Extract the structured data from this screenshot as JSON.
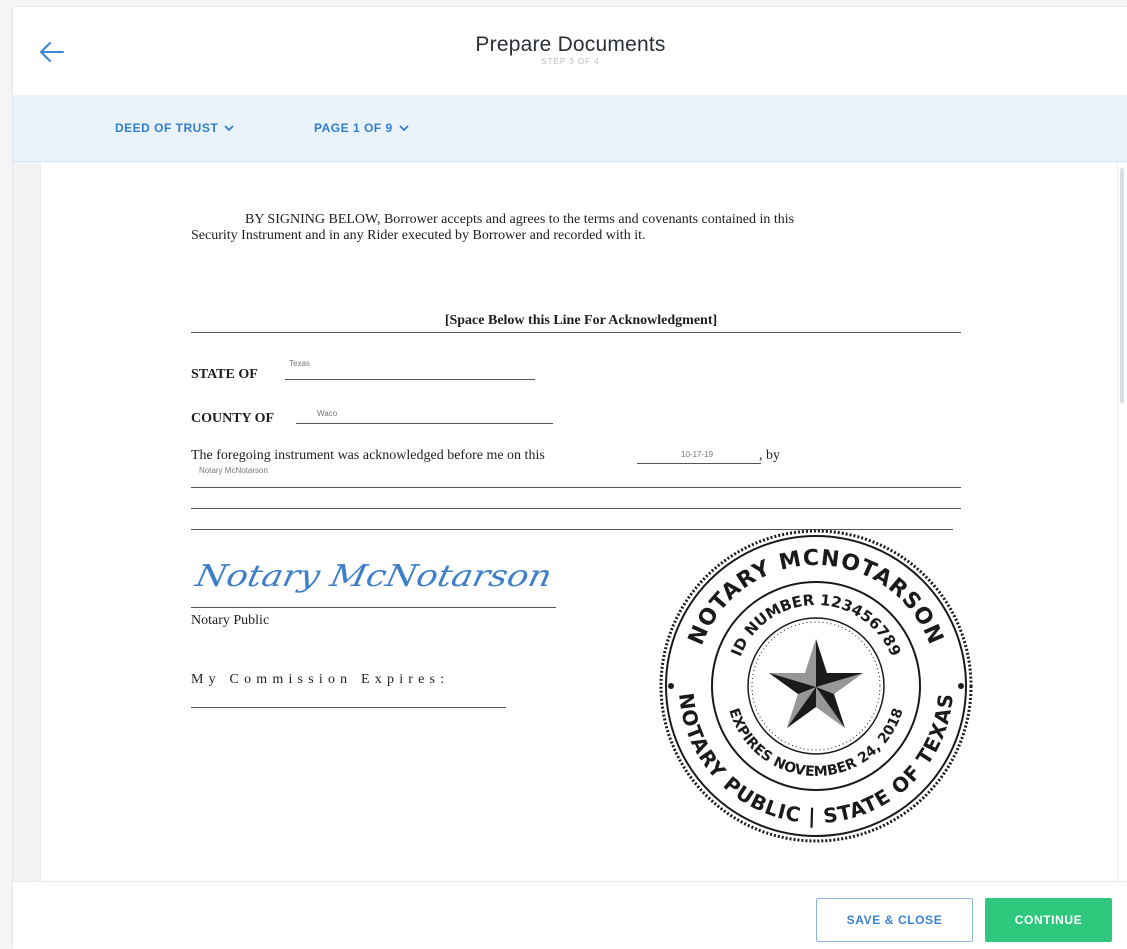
{
  "header": {
    "title": "Prepare Documents",
    "step": "STEP 3 OF 4",
    "back_icon": "arrow-left-icon"
  },
  "toolbar": {
    "document_select": "DEED OF TRUST",
    "page_select": "PAGE 1 OF 9",
    "accent": "#2f7fd0"
  },
  "document": {
    "intro_lead": "BY SIGNING BELOW, Borrower accepts and agrees to the terms and covenants contained in this",
    "intro_rest": "Security Instrument and in any Rider executed by Borrower and recorded with it.",
    "ack_heading": "[Space Below this Line For Acknowledgment]",
    "state_label": "STATE OF",
    "state_value": "Texas",
    "county_label": "COUNTY OF",
    "county_value": "Waco",
    "statement_text": "The foregoing instrument was acknowledged before me on this",
    "date_value": "10-17-19",
    "by_text": ", by",
    "name_value": "Notary McNotarson",
    "notary_public_label": "Notary Public",
    "commission_label": "My Commission Expires:",
    "signature_text": "Notary McNotarson",
    "seal": {
      "top_arc": "NOTARY MCNOTARSON",
      "id_arc": "ID NUMBER 123456789",
      "expires_arc": "EXPIRES NOVEMBER 24, 2018",
      "bottom_arc": "NOTARY PUBLIC | STATE OF TEXAS"
    }
  },
  "footer": {
    "save_close": "SAVE & CLOSE",
    "continue": "CONTINUE",
    "continue_color": "#2dc87b"
  }
}
